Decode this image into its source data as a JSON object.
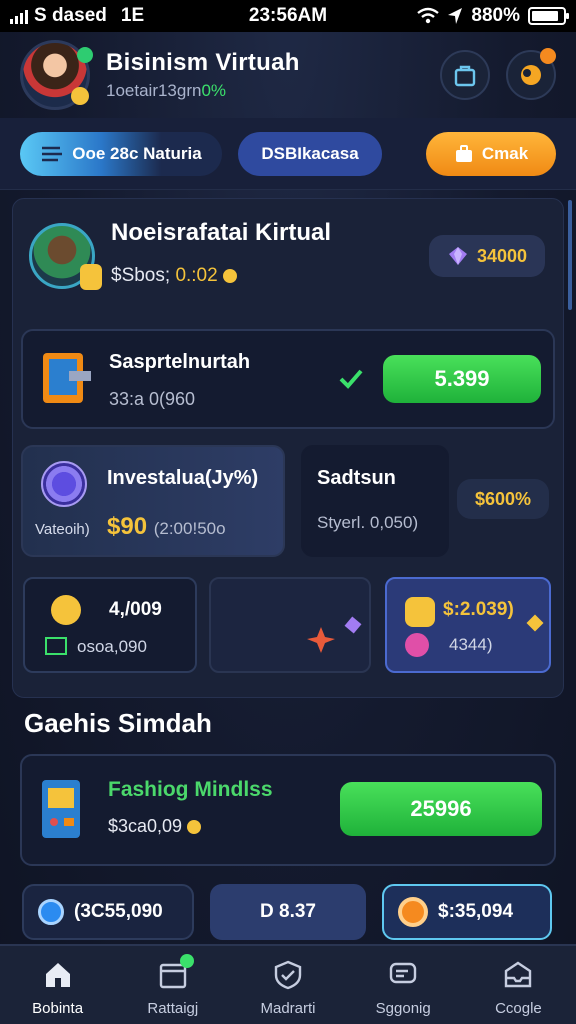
{
  "status_bar": {
    "left": "S dased",
    "network": "1E",
    "time": "23:56AM",
    "battery": "880%",
    "battery_level": 0.88
  },
  "header": {
    "title": "Bisinism Virtuah",
    "subtitle": "1oetair13grn",
    "subtitle_pct": "0%"
  },
  "pills": [
    {
      "label": "Ooe 28c Naturia",
      "icon": "menu-icon"
    },
    {
      "label": "DSBIkacasa"
    },
    {
      "label": "Cmak",
      "icon": "briefcase-icon"
    }
  ],
  "profile": {
    "name": "Noeisrafatai Kirtual",
    "balance_prefix": "$Sbos; ",
    "balance_value": "0.:02",
    "gems": "34000"
  },
  "card_a": {
    "title": "Sasprtelnurtah",
    "subtitle": "33:a 0(960",
    "button": "5.399"
  },
  "card_b": {
    "title": "Investalua(Jy%)",
    "label": "Vateoih)",
    "amount": "$90",
    "amount_extra": "(2:00!50o"
  },
  "card_c": {
    "title": "Sadtsun",
    "subtitle": "Styerl. 0,050)",
    "pct": "$600%"
  },
  "minis": {
    "m1": {
      "v1": "4,/009",
      "v2": "osoa,090"
    },
    "m3": {
      "v1": "$:2.039)",
      "v2": "4344)"
    }
  },
  "section": {
    "title": "Gaehis Simdah",
    "feature": {
      "title": "Fashiog Mindlss",
      "subtitle": "$3ca0,09",
      "button": "25996"
    }
  },
  "bottom_row": [
    {
      "label": "(3C55,090"
    },
    {
      "label": "D 8.37"
    },
    {
      "label": "$:35,094"
    }
  ],
  "nav": [
    {
      "label": "Bobinta",
      "icon": "home-icon"
    },
    {
      "label": "Rattaigj",
      "icon": "calendar-icon"
    },
    {
      "label": "Madrarti",
      "icon": "shield-check-icon"
    },
    {
      "label": "Sggonig",
      "icon": "chat-icon"
    },
    {
      "label": "Ccogle",
      "icon": "inbox-icon"
    }
  ],
  "colors": {
    "accent_green": "#3be06b",
    "accent_gold": "#f5c33b",
    "accent_orange": "#f08a14",
    "bg": "#141a2e"
  }
}
